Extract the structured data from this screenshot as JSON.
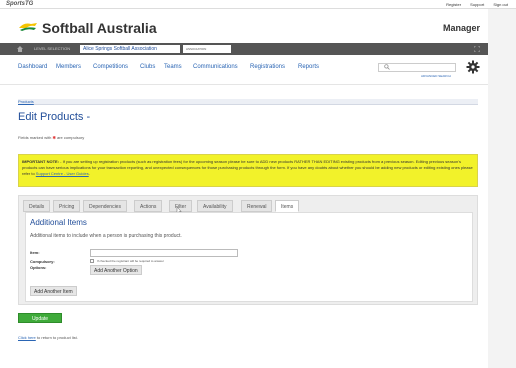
{
  "topbar": {
    "brand": "SportsTG",
    "links": [
      "Register",
      "Support",
      "Sign out"
    ]
  },
  "header": {
    "title": "Softball Australia",
    "section": "Manager"
  },
  "levelbar": {
    "label": "LEVEL SELECTION",
    "organisation": "Alice Springs Softball Association",
    "org_type": "ASSOCIATION"
  },
  "nav": {
    "items": [
      "Dashboard",
      "Members",
      "Competitions",
      "Clubs",
      "Teams",
      "Communications",
      "Registrations",
      "Reports"
    ],
    "search_placeholder": "",
    "advanced_search": "ADVANCED SEARCH"
  },
  "breadcrumb": "Products",
  "page": {
    "title": "Edit Products -",
    "compulsory_prefix": "Fields marked with ",
    "compulsory_mark": "✱",
    "compulsory_suffix": " are compulsory"
  },
  "warning": {
    "bold": "IMPORTANT NOTE:",
    "text": " - If you are setting up registration products (such as registration fees) for the upcoming season please be sure to ADD new products RATHER THAN EDITING existing products from a previous season. Editing previous season's products can have serious implications for your transaction reporting, and unexpected consequences for those purchasing products through the form. If you have any doubts about whether you should be adding new products or editing existing ones please refer to ",
    "link": "Support Centre - User Guides",
    "end": "."
  },
  "tabs": [
    "Details",
    "Pricing",
    "Dependencies",
    "Actions",
    "Filter",
    "Availability",
    "Renewal",
    "Items"
  ],
  "active_tab": "Items",
  "items_panel": {
    "title": "Additional Items",
    "description": "Additional items to include when a person is purchasing this product.",
    "item_label": "Item:",
    "item_value": "",
    "compulsory_label": "Compulsory:",
    "compulsory_text": "If checked the registrant will be required to answer",
    "options_label": "Options:",
    "add_option": "Add Another Option",
    "add_item": "Add Another Item"
  },
  "update_button": "Update",
  "return": {
    "link": "Click here",
    "text": " to return to product list."
  },
  "colors": {
    "accent_blue": "#234f9a",
    "link_blue": "#2a65b4",
    "warning_yellow": "#f2f22a",
    "update_green": "#3faa3a"
  }
}
